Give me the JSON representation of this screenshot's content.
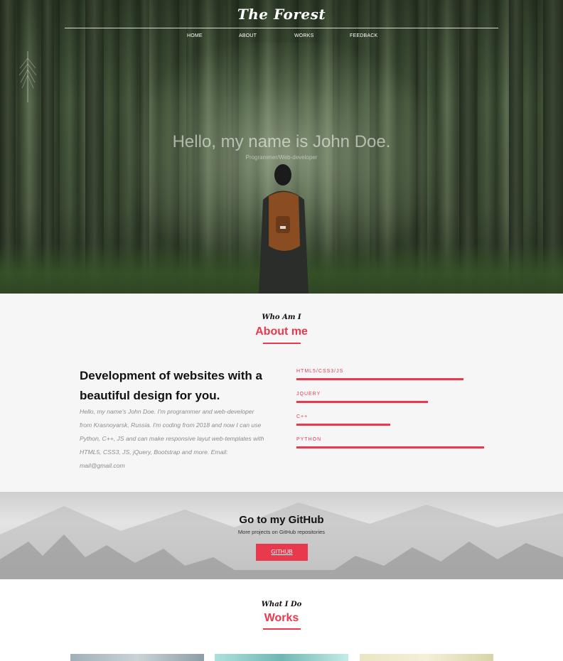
{
  "header": {
    "brand": "The Forest",
    "nav": [
      {
        "label": "HOME"
      },
      {
        "label": "ABOUT"
      },
      {
        "label": "WORKS"
      },
      {
        "label": "FEEDBACK"
      }
    ]
  },
  "hero": {
    "title": "Hello, my name is John Doe.",
    "subtitle": "Programmer/Web-developer"
  },
  "about": {
    "script_heading": "Who Am I",
    "title": "About me",
    "headline": "Development of websites with a beautiful design for you.",
    "text": "Hello, my name's John Doe. I'm programmer and web-developer from Krasnoyarsk, Russia. I'm coding from 2018 and now I can use Python, C++, JS and can make responsive layut web-templates with HTML5, CSS3, JS, jQuery, Bootstrap and more. Email: mail@gmail.com",
    "skills": [
      {
        "label": "HTML5/CSS3/JS",
        "level": 0.89
      },
      {
        "label": "JQUERY",
        "level": 0.7
      },
      {
        "label": "C++",
        "level": 0.5
      },
      {
        "label": "PYTHON",
        "level": 1.0
      }
    ]
  },
  "github": {
    "title": "Go to my GitHub",
    "subtitle": "More projects on GitHub repositories",
    "button": "GITHUB"
  },
  "works": {
    "script_heading": "What I Do",
    "title": "Works"
  },
  "colors": {
    "accent": "#e8394d"
  }
}
